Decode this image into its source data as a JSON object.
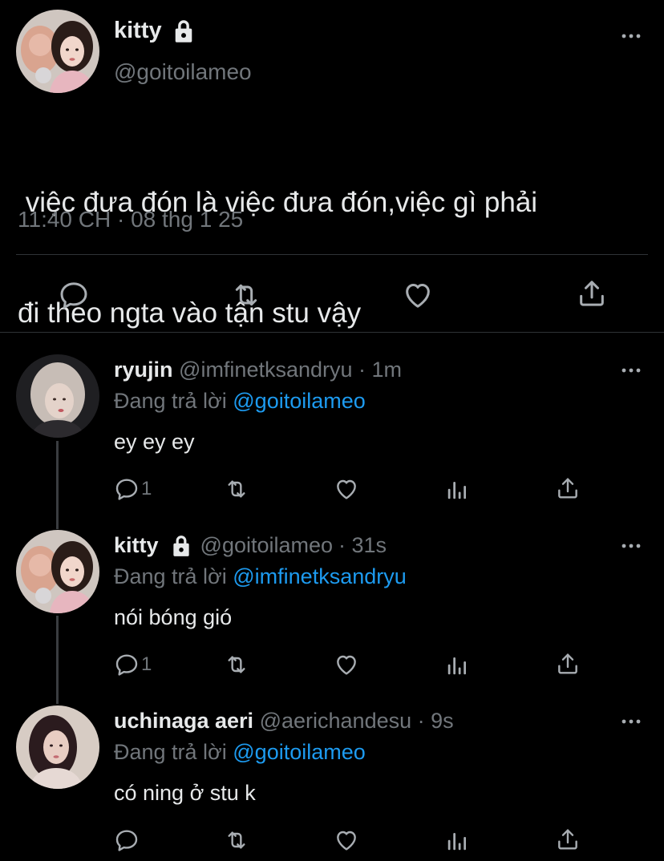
{
  "main_tweet": {
    "display_name": "kitty",
    "handle": "@goitoilameo",
    "text_line1": " việc đưa đón là việc đưa đón,việc gì phải",
    "text_line2": "đi theo ngta vào tận stu vậy",
    "timestamp": "11:40 CH · 08 thg 1 25"
  },
  "replies": [
    {
      "display_name": "ryujin",
      "handle": "@imfinetksandryu",
      "time": "· 1m",
      "replying_prefix": "Đang trả lời ",
      "replying_to": "@goitoilameo",
      "text": "ey ey ey",
      "reply_count": "1"
    },
    {
      "display_name": "kitty",
      "handle": "@goitoilameo",
      "time": "· 31s",
      "replying_prefix": "Đang trả lời ",
      "replying_to": "@imfinetksandryu",
      "text": "nói bóng gió",
      "reply_count": "1"
    },
    {
      "display_name": "uchinaga aeri",
      "handle": "@aerichandesu",
      "time": "· 9s",
      "replying_prefix": "Đang trả lời ",
      "replying_to": "@goitoilameo",
      "text": "có ning ở stu k",
      "reply_count": ""
    }
  ],
  "icons": {
    "reply": "reply-icon",
    "retweet": "retweet-icon",
    "like": "heart-icon",
    "analytics": "analytics-icon",
    "share": "share-icon",
    "lock": "lock-icon",
    "more": "more-icon"
  },
  "colors": {
    "background": "#000000",
    "text": "#e7e9ea",
    "secondary": "#71767b",
    "link": "#1d9bf0",
    "icon": "#a8adb2"
  }
}
